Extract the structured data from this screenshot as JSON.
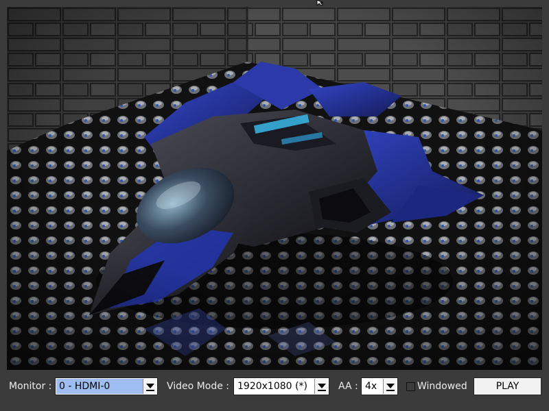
{
  "preview": {
    "description_icon": "spaceship-render"
  },
  "controls": {
    "monitor": {
      "label": "Monitor :",
      "value": "0 - HDMI-0",
      "highlight_color": "#9ebdf0"
    },
    "video_mode": {
      "label": "Video Mode :",
      "value": "1920x1080 (*)"
    },
    "aa": {
      "label": "AA :",
      "value": "4x"
    },
    "windowed": {
      "label": "Windowed",
      "checked": false
    },
    "play": {
      "label": "PLAY"
    }
  },
  "colors": {
    "background": "#3b3b3b",
    "text": "#ececec",
    "accent_blue": "#2a3fae"
  }
}
